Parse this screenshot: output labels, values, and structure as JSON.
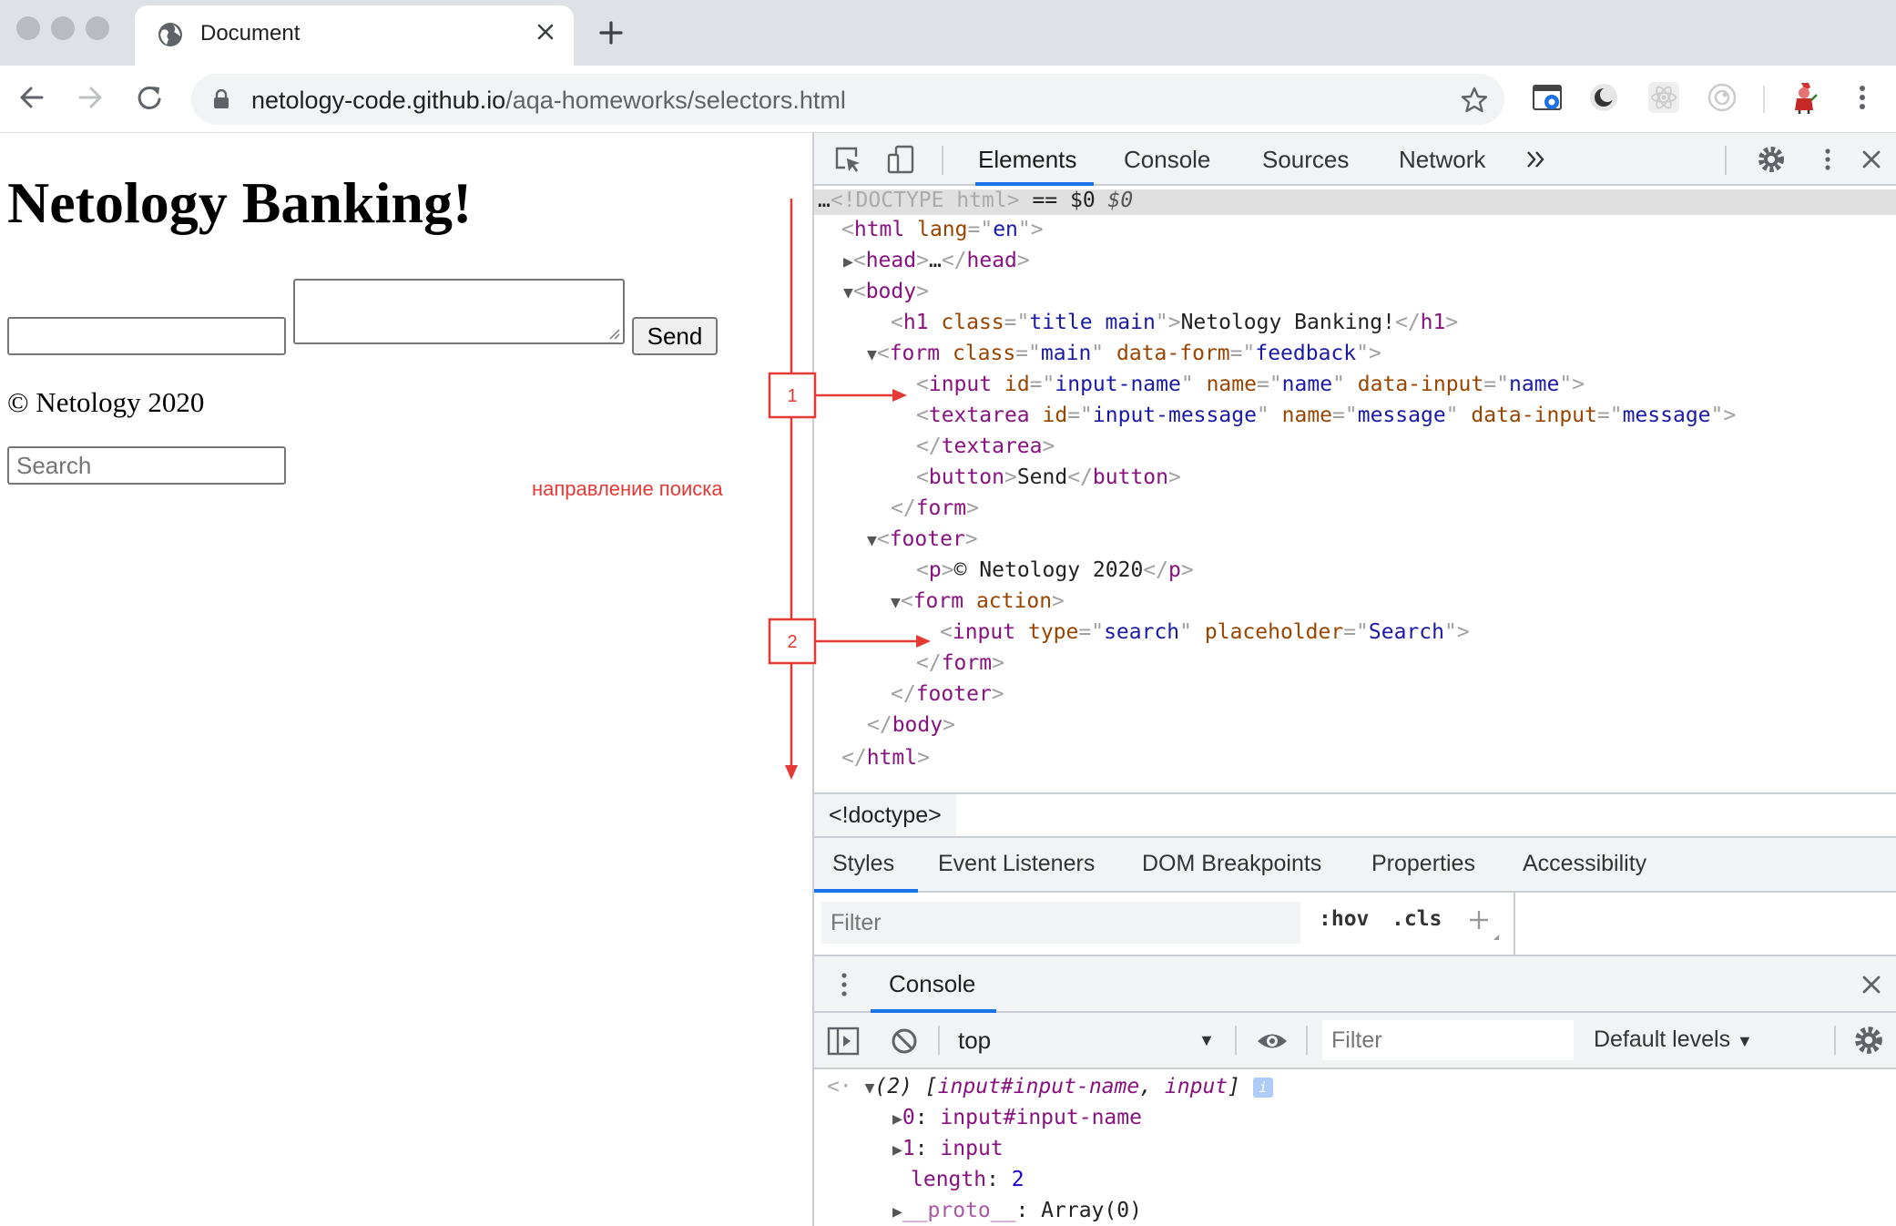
{
  "browser": {
    "tab_title": "Document",
    "url_host": "netology-code.github.io",
    "url_path": "/aqa-homeworks/selectors.html"
  },
  "page": {
    "heading": "Netology Banking!",
    "send_label": "Send",
    "copyright": "© Netology 2020",
    "search_placeholder": "Search",
    "search_direction_label": "направление поиска",
    "markers": [
      "1",
      "2"
    ]
  },
  "devtools": {
    "tabs": [
      "Elements",
      "Console",
      "Sources",
      "Network"
    ],
    "active_tab": "Elements",
    "dom": {
      "doctype": "<!DOCTYPE html>",
      "selected_marker": "== $0",
      "html_lang": "en",
      "h1_class": "title main",
      "h1_text": "Netology Banking!",
      "form_class": "main",
      "form_data_form": "feedback",
      "input_id": "input-name",
      "input_name": "name",
      "input_data_input": "name",
      "textarea_id": "input-message",
      "textarea_name": "message",
      "textarea_data_input": "message",
      "button_text": "Send",
      "footer_p_text": "© Netology 2020",
      "search_type": "search",
      "search_placeholder": "Search"
    },
    "breadcrumb": "<!doctype>",
    "subtabs": [
      "Styles",
      "Event Listeners",
      "DOM Breakpoints",
      "Properties",
      "Accessibility"
    ],
    "styles_filter_placeholder": "Filter",
    "hov": ":hov",
    "cls": ".cls",
    "drawer_title": "Console",
    "console_context": "top",
    "console_filter_placeholder": "Filter",
    "console_levels": "Default levels",
    "console_output": {
      "count": "(2)",
      "summary_item1": "input#input-name",
      "summary_item2": "input",
      "item0_key": "0",
      "item0_value": "input#input-name",
      "item1_key": "1",
      "item1_value": "input",
      "length_key": "length",
      "length_value": "2",
      "proto_key": "__proto__",
      "proto_value": "Array(0)"
    }
  },
  "colors": {
    "accent": "#1a73e8",
    "annotation": "#e53935",
    "tag": "#881280",
    "attr_name": "#994500",
    "attr_value": "#1a1aa6"
  }
}
